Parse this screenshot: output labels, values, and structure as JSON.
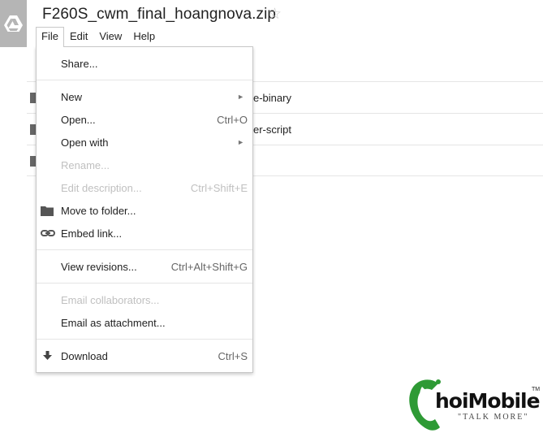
{
  "app": {
    "logo_icon": "google-drive-icon",
    "doc_title": "F260S_cwm_final_hoangnova.zip",
    "star_icon": "star-outline-icon",
    "star_glyph": "☆"
  },
  "menubar": [
    "File",
    "Edit",
    "View",
    "Help"
  ],
  "file_list": [
    {
      "name": "e-binary"
    },
    {
      "name": "er-script"
    },
    {
      "name": ""
    }
  ],
  "file_menu": {
    "items": [
      {
        "label": "Share...",
        "shortcut": "",
        "disabled": false
      },
      {
        "label": "New",
        "shortcut": "",
        "disabled": false,
        "arrow": "►"
      },
      {
        "label": "Open...",
        "shortcut": "Ctrl+O",
        "disabled": false
      },
      {
        "label": "Open with",
        "shortcut": "",
        "disabled": false,
        "arrow": "►"
      },
      {
        "label": "Rename...",
        "shortcut": "",
        "disabled": true
      },
      {
        "label": "Edit description...",
        "shortcut": "Ctrl+Shift+E",
        "disabled": true
      },
      {
        "label": "Move to folder...",
        "shortcut": "",
        "disabled": false,
        "icon": "folder-icon"
      },
      {
        "label": "Embed link...",
        "shortcut": "",
        "disabled": false,
        "icon": "link-icon"
      },
      {
        "label": "View revisions...",
        "shortcut": "Ctrl+Alt+Shift+G",
        "disabled": false
      },
      {
        "label": "Email collaborators...",
        "shortcut": "",
        "disabled": true
      },
      {
        "label": "Email as attachment...",
        "shortcut": "",
        "disabled": false
      },
      {
        "label": "Download",
        "shortcut": "Ctrl+S",
        "disabled": false,
        "icon": "download-icon"
      }
    ]
  },
  "watermark": {
    "brand_letter": "C",
    "brand_text": "hoiMobile",
    "tagline": "\"TALK MORE\"",
    "tm": "TM",
    "colors": {
      "green": "#2e9a35",
      "black": "#111111"
    }
  }
}
